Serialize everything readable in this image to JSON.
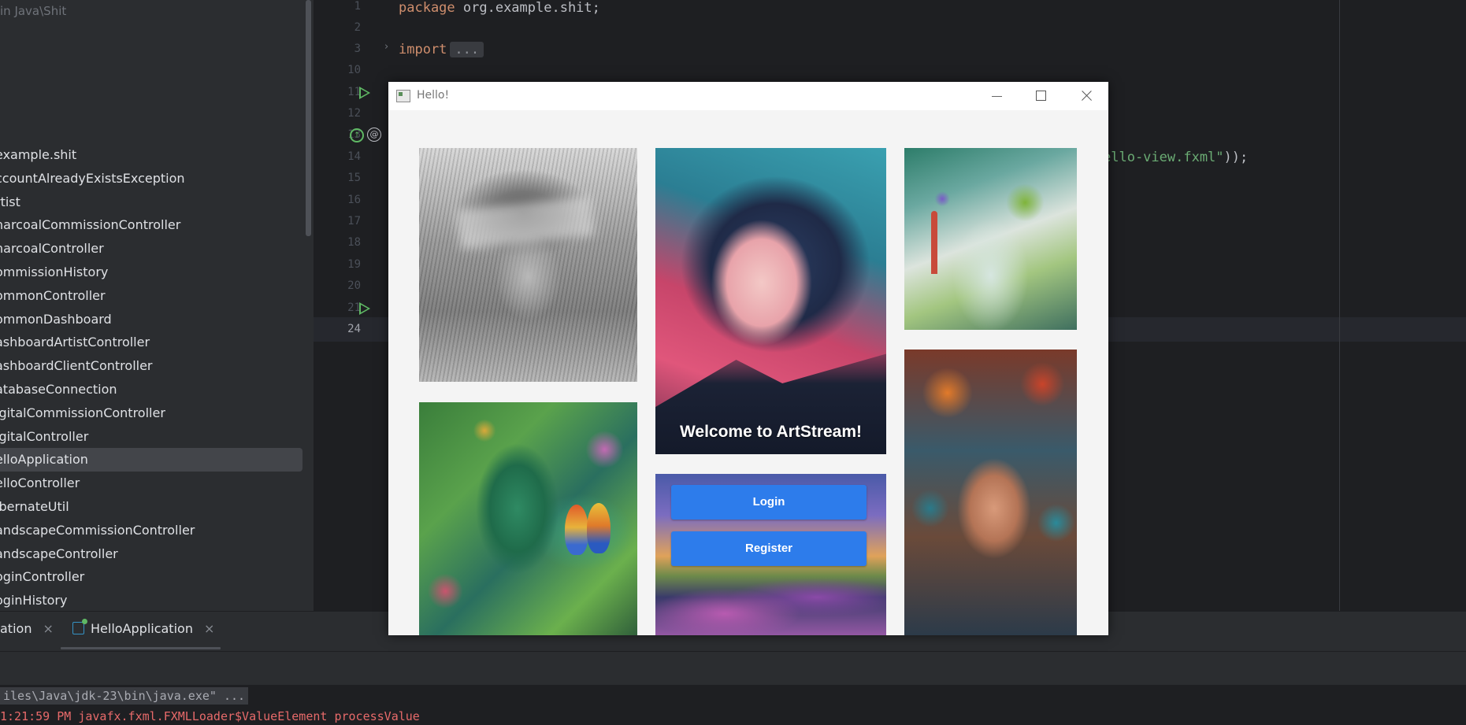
{
  "sidebar": {
    "path": "in Java\\Shit",
    "items": [
      "example.shit",
      "ccountAlreadyExistsException",
      "rtist",
      "harcoalCommissionController",
      "harcoalController",
      "ommissionHistory",
      "ommonController",
      "ommonDashboard",
      "ashboardArtistController",
      "ashboardClientController",
      "atabaseConnection",
      "igitalCommissionController",
      "igitalController",
      "elloApplication",
      "elloController",
      "ibernateUtil",
      "andscapeCommissionController",
      "andscapeController",
      "oginController",
      "oginHistory"
    ],
    "selected_index": 13
  },
  "editor": {
    "line_numbers": [
      "1",
      "2",
      "3",
      "10",
      "11",
      "12",
      "13",
      "14",
      "15",
      "16",
      "17",
      "18",
      "19",
      "20",
      "21",
      "24"
    ],
    "current_line": "24",
    "code": {
      "line1_kw": "package",
      "line1_rest": " org.example.shit;",
      "line3_kw": "import",
      "line3_fold": "...",
      "line14_str": "ello-view.fxml\"",
      "line14_end": "));"
    }
  },
  "run_panel": {
    "tab1": "ation",
    "tab2": "HelloApplication",
    "close_glyph": "×"
  },
  "console": {
    "command": "iles\\Java\\jdk-23\\bin\\java.exe\" ...",
    "error": "1:21:59 PM javafx.fxml.FXMLLoader$ValueElement processValue"
  },
  "fx_window": {
    "title": "Hello!",
    "welcome": "Welcome to ArtStream!",
    "login_label": "Login",
    "register_label": "Register"
  },
  "colors": {
    "ide_bg": "#1e1f22",
    "panel_bg": "#2b2d30",
    "keyword": "#cf8e6d",
    "string": "#6aab73",
    "button_blue": "#2d7ceb",
    "error_red": "#e76a6a"
  }
}
